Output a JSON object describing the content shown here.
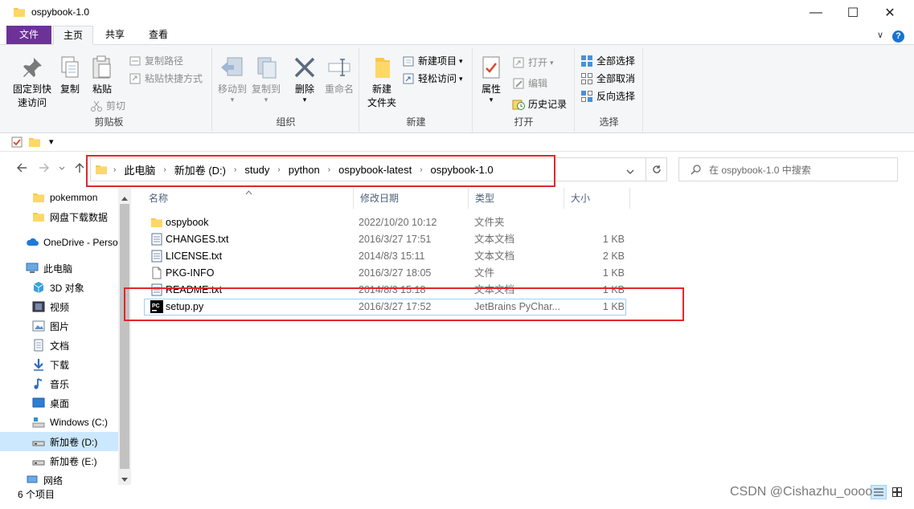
{
  "window": {
    "title": "ospybook-1.0",
    "minimize": "—",
    "maximize": "☐",
    "close": "✕"
  },
  "ribbon_tabs": {
    "file": "文件",
    "items": [
      "主页",
      "共享",
      "查看"
    ],
    "active": "主页",
    "collapse": "∨",
    "help": "?"
  },
  "ribbon": {
    "clipboard": {
      "label": "剪贴板",
      "pin_line1": "固定到快",
      "pin_line2": "速访问",
      "copy": "复制",
      "paste": "粘贴",
      "copy_path": "复制路径",
      "paste_shortcut": "粘贴快捷方式",
      "cut": "剪切"
    },
    "organize": {
      "label": "组织",
      "move_to": "移动到",
      "copy_to": "复制到",
      "delete": "删除",
      "rename": "重命名"
    },
    "new": {
      "label": "新建",
      "new_folder_line1": "新建",
      "new_folder_line2": "文件夹",
      "new_item": "新建项目",
      "easy_access": "轻松访问"
    },
    "open": {
      "label": "打开",
      "properties": "属性",
      "open": "打开",
      "edit": "编辑",
      "history": "历史记录"
    },
    "select": {
      "label": "选择",
      "select_all": "全部选择",
      "select_none": "全部取消",
      "invert": "反向选择"
    }
  },
  "qat": {
    "dropdown": "▾"
  },
  "address_bar": {
    "breadcrumbs": [
      "此电脑",
      "新加卷 (D:)",
      "study",
      "python",
      "ospybook-latest",
      "ospybook-1.0"
    ],
    "search_placeholder": "在 ospybook-1.0 中搜索"
  },
  "sidebar": {
    "items": [
      {
        "label": "pokemmon",
        "icon": "folder-icon"
      },
      {
        "label": "网盘下载数据",
        "icon": "folder-icon"
      },
      {
        "label": "OneDrive - Perso",
        "icon": "cloud-icon"
      },
      {
        "label": "此电脑",
        "icon": "computer-icon"
      },
      {
        "label": "3D 对象",
        "icon": "cube-icon"
      },
      {
        "label": "视频",
        "icon": "video-icon"
      },
      {
        "label": "图片",
        "icon": "picture-icon"
      },
      {
        "label": "文档",
        "icon": "document-icon"
      },
      {
        "label": "下载",
        "icon": "download-icon"
      },
      {
        "label": "音乐",
        "icon": "music-icon"
      },
      {
        "label": "桌面",
        "icon": "desktop-icon"
      },
      {
        "label": "Windows (C:)",
        "icon": "drive-icon"
      },
      {
        "label": "新加卷 (D:)",
        "icon": "drive-icon"
      },
      {
        "label": "新加卷 (E:)",
        "icon": "drive-icon"
      },
      {
        "label": "网络",
        "icon": "network-icon"
      }
    ],
    "selected": "新加卷 (D:)"
  },
  "file_list": {
    "columns": [
      "名称",
      "修改日期",
      "类型",
      "大小"
    ],
    "rows": [
      {
        "name": "ospybook",
        "date": "2022/10/20 10:12",
        "type": "文件夹",
        "size": "",
        "icon": "folder-icon"
      },
      {
        "name": "CHANGES.txt",
        "date": "2016/3/27 17:51",
        "type": "文本文档",
        "size": "1 KB",
        "icon": "text-file-icon"
      },
      {
        "name": "LICENSE.txt",
        "date": "2014/8/3 15:11",
        "type": "文本文档",
        "size": "2 KB",
        "icon": "text-file-icon"
      },
      {
        "name": "PKG-INFO",
        "date": "2016/3/27 18:05",
        "type": "文件",
        "size": "1 KB",
        "icon": "file-icon"
      },
      {
        "name": "README.txt",
        "date": "2014/8/3 15:18",
        "type": "文本文档",
        "size": "1 KB",
        "icon": "text-file-icon"
      },
      {
        "name": "setup.py",
        "date": "2016/3/27 17:52",
        "type": "JetBrains PyChar...",
        "size": "1 KB",
        "icon": "pycharm-icon"
      }
    ],
    "selected": "setup.py"
  },
  "status_bar": {
    "item_count": "6 个项目"
  },
  "watermark": "CSDN @Cishazhu_oooo",
  "colors": {
    "file_tab": "#6d3297",
    "selection": "#cce8ff",
    "highlight_box": "#e0272d",
    "folder": "#f8c94a"
  }
}
